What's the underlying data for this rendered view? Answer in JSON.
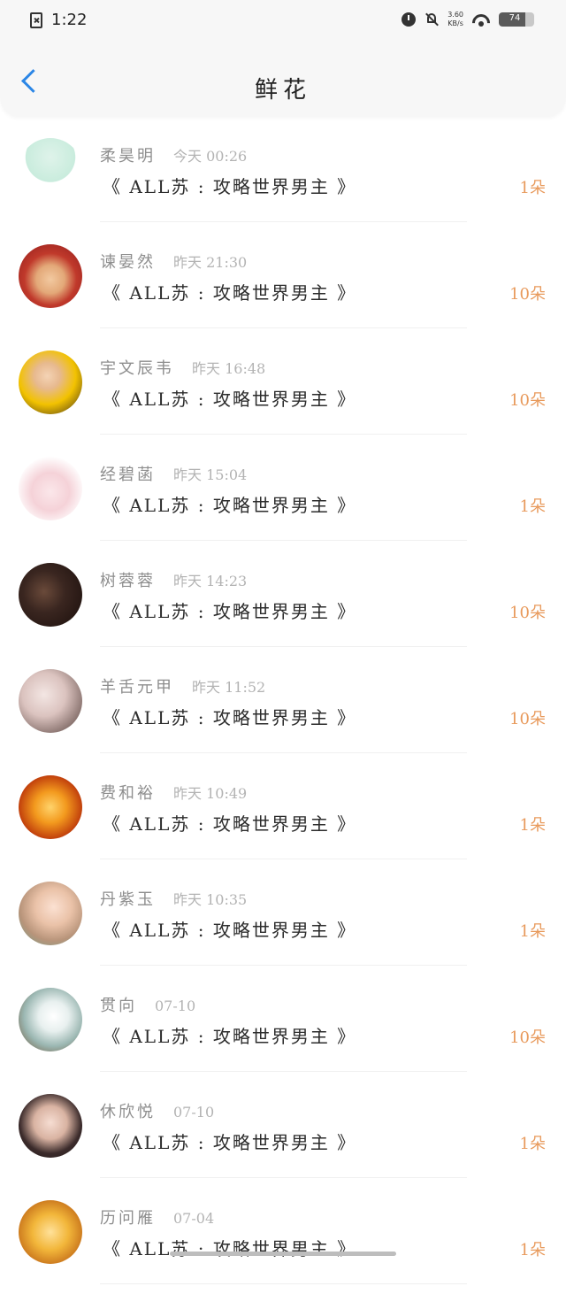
{
  "status_bar": {
    "time": "1:22",
    "net_speed_value": "3.60",
    "net_speed_unit": "KB/s",
    "battery_level": "74",
    "battery_fraction": 0.74
  },
  "header": {
    "title": "鲜花"
  },
  "colors": {
    "accent_blue": "#2b86e6",
    "count_orange": "#e89a5c"
  },
  "items": [
    {
      "name": "柔昊明",
      "time": "今天 00:26",
      "book": "《 ALL苏 : 攻略世界男主 》",
      "count": "1朵",
      "avatar_bg": "radial-gradient(circle at 50% 30%, #dff3ea 0%, #c9ecdd 45%, #ffffff 46%, #ffffff 100%)"
    },
    {
      "name": "谏晏然",
      "time": "昨天 21:30",
      "book": "《 ALL苏 : 攻略世界男主 》",
      "count": "10朵",
      "avatar_bg": "radial-gradient(circle at 50% 55%, #f2c9a0 0%, #e3a878 30%, #c0392b 55%, #8e1b1b 100%)"
    },
    {
      "name": "宇文辰韦",
      "time": "昨天 16:48",
      "book": "《 ALL苏 : 攻略世界男主 》",
      "count": "10朵",
      "avatar_bg": "radial-gradient(circle at 45% 40%, #f4d3b5 0%, #e7b98f 25%, #f2c200 55%, #3a2a1a 100%)"
    },
    {
      "name": "经碧菡",
      "time": "昨天 15:04",
      "book": "《 ALL苏 : 攻略世界男主 》",
      "count": "1朵",
      "avatar_bg": "radial-gradient(circle at 50% 55%, #fbe7ea 0%, #f5d2d8 40%, #ffffff 75%, #ffffff 100%)"
    },
    {
      "name": "树蓉蓉",
      "time": "昨天 14:23",
      "book": "《 ALL苏 : 攻略世界男主 》",
      "count": "10朵",
      "avatar_bg": "radial-gradient(circle at 40% 45%, #6a4a3a 0%, #3a2620 40%, #1a0e0b 100%)"
    },
    {
      "name": "羊舌元甲",
      "time": "昨天 11:52",
      "book": "《 ALL苏 : 攻略世界男主 》",
      "count": "10朵",
      "avatar_bg": "radial-gradient(circle at 40% 40%, #f3e6e3 0%, #dbc3bf 40%, #8a7470 75%, #e8e0de 100%)"
    },
    {
      "name": "费和裕",
      "time": "昨天 10:49",
      "book": "《 ALL苏 : 攻略世界男主 》",
      "count": "1朵",
      "avatar_bg": "radial-gradient(circle at 50% 50%, #ffd36b 0%, #f39a1e 35%, #c2410c 70%, #6b1d05 100%)"
    },
    {
      "name": "丹紫玉",
      "time": "昨天 10:35",
      "book": "《 ALL苏 : 攻略世界男主 》",
      "count": "1朵",
      "avatar_bg": "radial-gradient(circle at 55% 40%, #fbe1d2 0%, #eac2a8 35%, #b8947a 65%, #6fa38e 100%)"
    },
    {
      "name": "贯向",
      "time": "07-10",
      "book": "《 ALL苏 : 攻略世界男主 》",
      "count": "10朵",
      "avatar_bg": "radial-gradient(circle at 55% 45%, #ffffff 0%, #e8f0ef 30%, #9bb7b2 60%, #6b4a2a 100%)"
    },
    {
      "name": "休欣悦",
      "time": "07-10",
      "book": "《 ALL苏 : 攻略世界男主 》",
      "count": "1朵",
      "avatar_bg": "radial-gradient(circle at 50% 45%, #f6ddd2 0%, #d9b3a2 35%, #3b2b2b 65%, #1d1414 100%)"
    },
    {
      "name": "历问雁",
      "time": "07-04",
      "book": "《 ALL苏 : 攻略世界男主 》",
      "count": "1朵",
      "avatar_bg": "radial-gradient(circle at 50% 50%, #ffe19a 0%, #f2b63a 40%, #c9751c 75%, #ffffff 100%)"
    }
  ]
}
